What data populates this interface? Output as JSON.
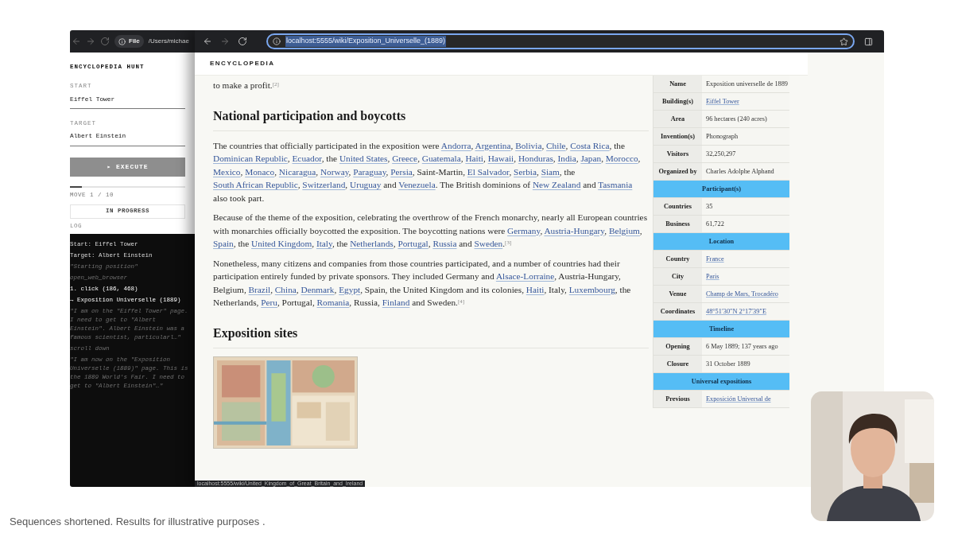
{
  "left_window": {
    "toolbar": {
      "file_chip": "File",
      "path": "/Users/michae"
    },
    "app_title": "ENCYCLOPEDIA HUNT",
    "fields": [
      {
        "label": "START",
        "value": "Eiffel Tower"
      },
      {
        "label": "TARGET",
        "value": "Albert Einstein"
      }
    ],
    "execute_button": {
      "label": "▸ EXECUTE",
      "disabled": true
    },
    "progress": {
      "level": 0.1
    },
    "move_counter": "MOVE 1 / 10",
    "status": "IN PROGRESS",
    "log_label": "LOG",
    "log": [
      {
        "kind": "info",
        "text": "Start: Eiffel Tower"
      },
      {
        "kind": "info",
        "text": "Target: Albert Einstein"
      },
      {
        "kind": "thought",
        "text": "\"Starting position\""
      },
      {
        "kind": "thought",
        "text": "open_web_browser"
      },
      {
        "kind": "action",
        "text": "1. click (186, 468)"
      },
      {
        "kind": "action",
        "text": "→ Exposition Universelle (1889)"
      },
      {
        "kind": "thought",
        "text": "\"I am on the \"Eiffel Tower\" page. I need to get to \"Albert Einstein\". Albert Einstein was a famous scientist, particularl…\""
      },
      {
        "kind": "thought",
        "text": "scroll down"
      },
      {
        "kind": "thought",
        "text": "\"I am now on the \"Exposition Universelle (1889)\" page. This is the 1889 World's Fair. I need to get to \"Albert Einstein\"…\""
      }
    ]
  },
  "browser": {
    "address": "localhost:5555/wiki/Exposition_Universelle_(1889)",
    "site_title": "ENCYCLOPEDIA",
    "article": [
      {
        "kind": "paragraph",
        "parts": [
          "to make a profit."
        ],
        "ref": "[2]"
      },
      {
        "kind": "heading",
        "text": "National participation and boycotts"
      },
      {
        "kind": "paragraph",
        "parts": [
          "The countries that officially participated in the exposition were ",
          "Andorra",
          ", ",
          "Argentina",
          ", ",
          "Bolivia",
          ", ",
          "Chile",
          ", ",
          "Costa Rica",
          ", the ",
          "Dominican Republic",
          ", ",
          "Ecuador",
          ", the ",
          "United States",
          ", ",
          "Greece",
          ", ",
          "Guatemala",
          ", ",
          "Haiti",
          ", ",
          "Hawaii",
          ", ",
          "Honduras",
          ", ",
          "India",
          ", ",
          "Japan",
          ", ",
          "Morocco",
          ", ",
          "Mexico",
          ", ",
          "Monaco",
          ", ",
          "Nicaragua",
          ", ",
          "Norway",
          ", ",
          "Paraguay",
          ", ",
          "Persia",
          ", Saint-Martin, ",
          "El Salvador",
          ", ",
          "Serbia",
          ", ",
          "Siam",
          ", the ",
          "South African Republic",
          ", ",
          "Switzerland",
          ", ",
          "Uruguay",
          " and ",
          "Venezuela",
          ". The British dominions of ",
          "New Zealand",
          " and ",
          "Tasmania",
          " also took part."
        ]
      },
      {
        "kind": "paragraph",
        "parts": [
          "Because of the theme of the exposition, celebrating the overthrow of the French monarchy, nearly all European countries with monarchies officially boycotted the exposition. The boycotting nations were ",
          "Germany",
          ", ",
          "Austria-Hungary",
          ", ",
          "Belgium",
          ", ",
          "Spain",
          ", the ",
          "United Kingdom",
          ", ",
          "Italy",
          ", the ",
          "Netherlands",
          ", ",
          "Portugal",
          ", ",
          "Russia",
          " and ",
          "Sweden",
          "."
        ],
        "ref": "[3]"
      },
      {
        "kind": "paragraph",
        "parts": [
          "Nonetheless, many citizens and companies from those countries participated, and a number of countries had their participation entirely funded by private sponsors. They included Germany and ",
          "Alsace-Lorraine",
          ", Austria-Hungary, Belgium, ",
          "Brazil",
          ", ",
          "China",
          ", ",
          "Denmark",
          ", ",
          "Egypt",
          ", Spain, the United Kingdom and its colonies, ",
          "Haiti",
          ", Italy, ",
          "Luxembourg",
          ", the Netherlands, ",
          "Peru",
          ", Portugal, ",
          "Romania",
          ", Russia, ",
          "Finland",
          " and Sweden."
        ],
        "ref": "[4]"
      },
      {
        "kind": "heading",
        "text": "Exposition sites"
      },
      {
        "kind": "figure"
      }
    ],
    "infobox": [
      {
        "kind": "row",
        "label": "Name",
        "value": "Exposition universelle de 1889",
        "linked": false
      },
      {
        "kind": "row",
        "label": "Building(s)",
        "value": "Eiffel Tower",
        "linked": true
      },
      {
        "kind": "row",
        "label": "Area",
        "value": "96 hectares (240 acres)",
        "linked": false
      },
      {
        "kind": "row",
        "label": "Invention(s)",
        "value": "Phonograph",
        "linked": false
      },
      {
        "kind": "row",
        "label": "Visitors",
        "value": "32,250,297",
        "linked": false
      },
      {
        "kind": "row",
        "label": "Organized by",
        "value": "Charles Adolphe Alphand",
        "linked": false
      },
      {
        "kind": "section",
        "label": "Participant(s)"
      },
      {
        "kind": "row",
        "label": "Countries",
        "value": "35",
        "linked": false
      },
      {
        "kind": "row",
        "label": "Business",
        "value": "61,722",
        "linked": false
      },
      {
        "kind": "section",
        "label": "Location"
      },
      {
        "kind": "row",
        "label": "Country",
        "value": "France",
        "linked": true
      },
      {
        "kind": "row",
        "label": "City",
        "value": "Paris",
        "linked": true
      },
      {
        "kind": "row",
        "label": "Venue",
        "value": "Champ de Mars, Trocadéro",
        "linked": true
      },
      {
        "kind": "row",
        "label": "Coordinates",
        "value": "48°51′30″N 2°17′39″E",
        "linked": true
      },
      {
        "kind": "section",
        "label": "Timeline"
      },
      {
        "kind": "row",
        "label": "Opening",
        "value": "6 May 1889; 137 years ago",
        "linked": false
      },
      {
        "kind": "row",
        "label": "Closure",
        "value": "31 October 1889",
        "linked": false
      },
      {
        "kind": "section",
        "label": "Universal expositions"
      },
      {
        "kind": "row",
        "label": "Previous",
        "value": "Exposición Universal de",
        "linked": true
      }
    ],
    "status_url": "localhost:5555/wiki/United_Kingdom_of_Great_Britain_and_Ireland"
  },
  "caption": "Sequences shortened. Results for illustrative purposes ."
}
